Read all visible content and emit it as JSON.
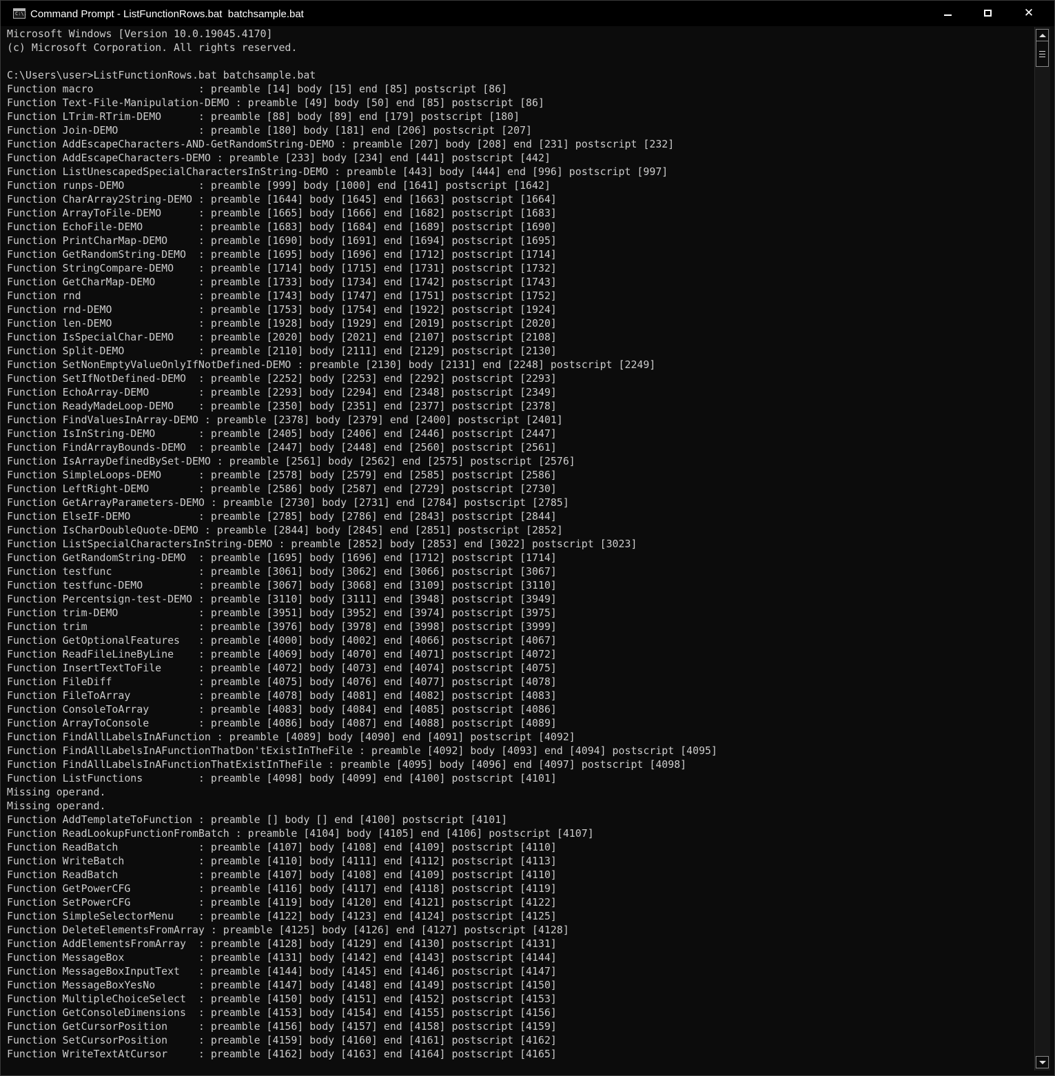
{
  "window": {
    "title": "Command Prompt - ListFunctionRows.bat  batchsample.bat",
    "icon": "console-icon",
    "icon_text": "C:\\."
  },
  "console": {
    "lines": [
      "Microsoft Windows [Version 10.0.19045.4170]",
      "(c) Microsoft Corporation. All rights reserved.",
      "",
      "C:\\Users\\user>ListFunctionRows.bat batchsample.bat",
      "Function macro                 : preamble [14] body [15] end [85] postscript [86]",
      "Function Text-File-Manipulation-DEMO : preamble [49] body [50] end [85] postscript [86]",
      "Function LTrim-RTrim-DEMO      : preamble [88] body [89] end [179] postscript [180]",
      "Function Join-DEMO             : preamble [180] body [181] end [206] postscript [207]",
      "Function AddEscapeCharacters-AND-GetRandomString-DEMO : preamble [207] body [208] end [231] postscript [232]",
      "Function AddEscapeCharacters-DEMO : preamble [233] body [234] end [441] postscript [442]",
      "Function ListUnescapedSpecialCharactersInString-DEMO : preamble [443] body [444] end [996] postscript [997]",
      "Function runps-DEMO            : preamble [999] body [1000] end [1641] postscript [1642]",
      "Function CharArray2String-DEMO : preamble [1644] body [1645] end [1663] postscript [1664]",
      "Function ArrayToFile-DEMO      : preamble [1665] body [1666] end [1682] postscript [1683]",
      "Function EchoFile-DEMO         : preamble [1683] body [1684] end [1689] postscript [1690]",
      "Function PrintCharMap-DEMO     : preamble [1690] body [1691] end [1694] postscript [1695]",
      "Function GetRandomString-DEMO  : preamble [1695] body [1696] end [1712] postscript [1714]",
      "Function StringCompare-DEMO    : preamble [1714] body [1715] end [1731] postscript [1732]",
      "Function GetCharMap-DEMO       : preamble [1733] body [1734] end [1742] postscript [1743]",
      "Function rnd                   : preamble [1743] body [1747] end [1751] postscript [1752]",
      "Function rnd-DEMO              : preamble [1753] body [1754] end [1922] postscript [1924]",
      "Function len-DEMO              : preamble [1928] body [1929] end [2019] postscript [2020]",
      "Function IsSpecialChar-DEMO    : preamble [2020] body [2021] end [2107] postscript [2108]",
      "Function Split-DEMO            : preamble [2110] body [2111] end [2129] postscript [2130]",
      "Function SetNonEmptyValueOnlyIfNotDefined-DEMO : preamble [2130] body [2131] end [2248] postscript [2249]",
      "Function SetIfNotDefined-DEMO  : preamble [2252] body [2253] end [2292] postscript [2293]",
      "Function EchoArray-DEMO        : preamble [2293] body [2294] end [2348] postscript [2349]",
      "Function ReadyMadeLoop-DEMO    : preamble [2350] body [2351] end [2377] postscript [2378]",
      "Function FindValuesInArray-DEMO : preamble [2378] body [2379] end [2400] postscript [2401]",
      "Function IsInString-DEMO       : preamble [2405] body [2406] end [2446] postscript [2447]",
      "Function FindArrayBounds-DEMO  : preamble [2447] body [2448] end [2560] postscript [2561]",
      "Function IsArrayDefinedBySet-DEMO : preamble [2561] body [2562] end [2575] postscript [2576]",
      "Function SimpleLoops-DEMO      : preamble [2578] body [2579] end [2585] postscript [2586]",
      "Function LeftRight-DEMO        : preamble [2586] body [2587] end [2729] postscript [2730]",
      "Function GetArrayParameters-DEMO : preamble [2730] body [2731] end [2784] postscript [2785]",
      "Function ElseIF-DEMO           : preamble [2785] body [2786] end [2843] postscript [2844]",
      "Function IsCharDoubleQuote-DEMO : preamble [2844] body [2845] end [2851] postscript [2852]",
      "Function ListSpecialCharactersInString-DEMO : preamble [2852] body [2853] end [3022] postscript [3023]",
      "Function GetRandomString-DEMO  : preamble [1695] body [1696] end [1712] postscript [1714]",
      "Function testfunc              : preamble [3061] body [3062] end [3066] postscript [3067]",
      "Function testfunc-DEMO         : preamble [3067] body [3068] end [3109] postscript [3110]",
      "Function Percentsign-test-DEMO : preamble [3110] body [3111] end [3948] postscript [3949]",
      "Function trim-DEMO             : preamble [3951] body [3952] end [3974] postscript [3975]",
      "Function trim                  : preamble [3976] body [3978] end [3998] postscript [3999]",
      "Function GetOptionalFeatures   : preamble [4000] body [4002] end [4066] postscript [4067]",
      "Function ReadFileLineByLine    : preamble [4069] body [4070] end [4071] postscript [4072]",
      "Function InsertTextToFile      : preamble [4072] body [4073] end [4074] postscript [4075]",
      "Function FileDiff              : preamble [4075] body [4076] end [4077] postscript [4078]",
      "Function FileToArray           : preamble [4078] body [4081] end [4082] postscript [4083]",
      "Function ConsoleToArray        : preamble [4083] body [4084] end [4085] postscript [4086]",
      "Function ArrayToConsole        : preamble [4086] body [4087] end [4088] postscript [4089]",
      "Function FindAllLabelsInAFunction : preamble [4089] body [4090] end [4091] postscript [4092]",
      "Function FindAllLabelsInAFunctionThatDon'tExistInTheFile : preamble [4092] body [4093] end [4094] postscript [4095]",
      "Function FindAllLabelsInAFunctionThatExistInTheFile : preamble [4095] body [4096] end [4097] postscript [4098]",
      "Function ListFunctions         : preamble [4098] body [4099] end [4100] postscript [4101]",
      "Missing operand.",
      "Missing operand.",
      "Function AddTemplateToFunction : preamble [] body [] end [4100] postscript [4101]",
      "Function ReadLookupFunctionFromBatch : preamble [4104] body [4105] end [4106] postscript [4107]",
      "Function ReadBatch             : preamble [4107] body [4108] end [4109] postscript [4110]",
      "Function WriteBatch            : preamble [4110] body [4111] end [4112] postscript [4113]",
      "Function ReadBatch             : preamble [4107] body [4108] end [4109] postscript [4110]",
      "Function GetPowerCFG           : preamble [4116] body [4117] end [4118] postscript [4119]",
      "Function SetPowerCFG           : preamble [4119] body [4120] end [4121] postscript [4122]",
      "Function SimpleSelectorMenu    : preamble [4122] body [4123] end [4124] postscript [4125]",
      "Function DeleteElementsFromArray : preamble [4125] body [4126] end [4127] postscript [4128]",
      "Function AddElementsFromArray  : preamble [4128] body [4129] end [4130] postscript [4131]",
      "Function MessageBox            : preamble [4131] body [4142] end [4143] postscript [4144]",
      "Function MessageBoxInputText   : preamble [4144] body [4145] end [4146] postscript [4147]",
      "Function MessageBoxYesNo       : preamble [4147] body [4148] end [4149] postscript [4150]",
      "Function MultipleChoiceSelect  : preamble [4150] body [4151] end [4152] postscript [4153]",
      "Function GetConsoleDimensions  : preamble [4153] body [4154] end [4155] postscript [4156]",
      "Function GetCursorPosition     : preamble [4156] body [4157] end [4158] postscript [4159]",
      "Function SetCursorPosition     : preamble [4159] body [4160] end [4161] postscript [4162]",
      "Function WriteTextAtCursor     : preamble [4162] body [4163] end [4164] postscript [4165]"
    ]
  },
  "colors": {
    "background": "#0c0c0c",
    "text": "#cccccc",
    "titlebar": "#000000"
  }
}
